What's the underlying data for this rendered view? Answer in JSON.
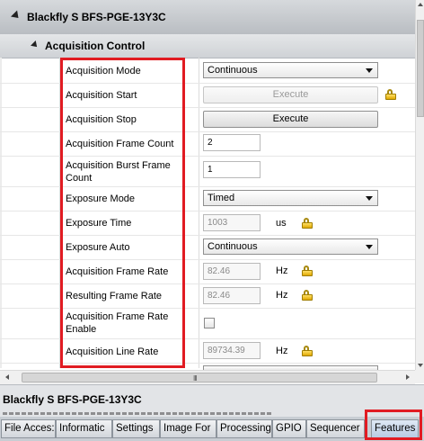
{
  "device_title": "Blackfly S BFS-PGE-13Y3C",
  "section_title": "Acquisition Control",
  "rows": {
    "acq_mode": {
      "label": "Acquisition Mode",
      "value": "Continuous"
    },
    "acq_start": {
      "label": "Acquisition Start",
      "button": "Execute"
    },
    "acq_stop": {
      "label": "Acquisition Stop",
      "button": "Execute"
    },
    "frame_count": {
      "label": "Acquisition Frame Count",
      "value": "2"
    },
    "burst_count": {
      "label": "Acquisition Burst Frame Count",
      "value": "1"
    },
    "exposure_mode": {
      "label": "Exposure Mode",
      "value": "Timed"
    },
    "exposure_time": {
      "label": "Exposure Time",
      "value": "1003",
      "unit": "us"
    },
    "exposure_auto": {
      "label": "Exposure Auto",
      "value": "Continuous"
    },
    "frame_rate": {
      "label": "Acquisition Frame Rate",
      "value": "82.46",
      "unit": "Hz"
    },
    "resulting_rate": {
      "label": "Resulting Frame Rate",
      "value": "82.46",
      "unit": "Hz"
    },
    "frame_rate_enable": {
      "label": "Acquisition Frame Rate Enable",
      "checked": false
    },
    "line_rate": {
      "label": "Acquisition Line Rate",
      "value": "89734.39",
      "unit": "Hz"
    }
  },
  "hscroll_grip": "III",
  "description_title": "Blackfly S BFS-PGE-13Y3C",
  "tabs": [
    "File Acces:",
    "Informatic",
    "Settings",
    "Image For",
    "Processing",
    "GPIO",
    "Sequencer",
    "Features"
  ],
  "active_tab": "Features",
  "colors": {
    "highlight": "#e11b22",
    "lock": "#e0a800"
  }
}
